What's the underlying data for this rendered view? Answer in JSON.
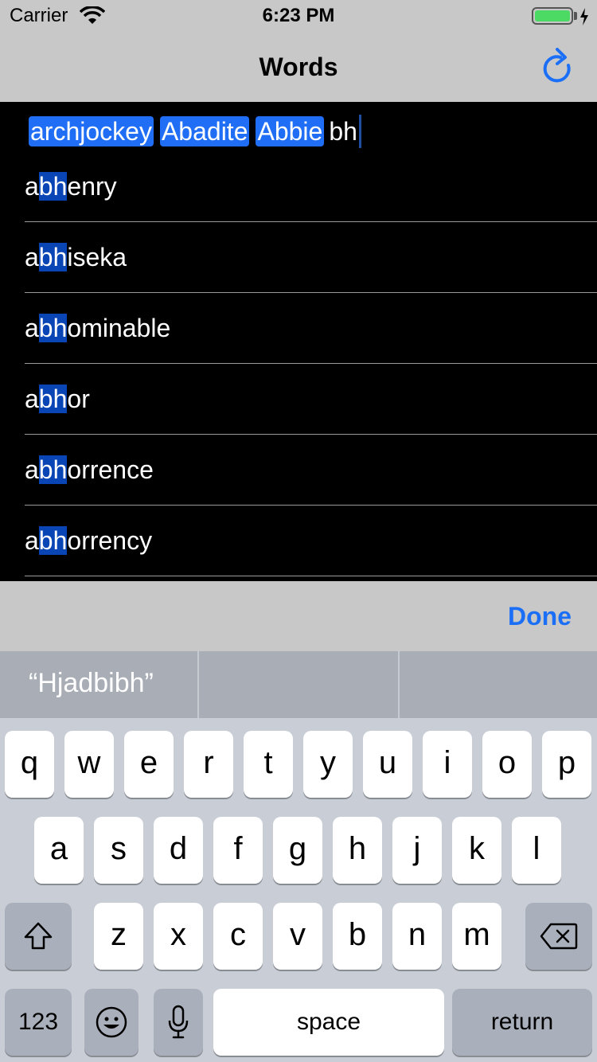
{
  "status_bar": {
    "carrier": "Carrier",
    "time": "6:23 PM",
    "battery_level": 1.0,
    "battery_color": "#4cd964",
    "icons": [
      "wifi-icon",
      "battery-icon",
      "charging-bolt-icon"
    ]
  },
  "nav": {
    "title": "Words",
    "right_icon": "refresh-icon",
    "accent": "#1a6ff6"
  },
  "token_field": {
    "tokens": [
      "archjockey",
      "Abadite",
      "Abbie"
    ],
    "typed": "bh"
  },
  "results": [
    {
      "prefix": "a",
      "match": "bh",
      "rest": "enry"
    },
    {
      "prefix": "a",
      "match": "bh",
      "rest": "iseka"
    },
    {
      "prefix": "a",
      "match": "bh",
      "rest": "ominable"
    },
    {
      "prefix": "a",
      "match": "bh",
      "rest": "or"
    },
    {
      "prefix": "a",
      "match": "bh",
      "rest": "orrence"
    },
    {
      "prefix": "a",
      "match": "bh",
      "rest": "orrency"
    }
  ],
  "accessory": {
    "done_label": "Done"
  },
  "predictive": {
    "suggestions": [
      "“Hjadbibh”",
      "",
      ""
    ]
  },
  "keyboard": {
    "row1": [
      "q",
      "w",
      "e",
      "r",
      "t",
      "y",
      "u",
      "i",
      "o",
      "p"
    ],
    "row2": [
      "a",
      "s",
      "d",
      "f",
      "g",
      "h",
      "j",
      "k",
      "l"
    ],
    "row3": [
      "z",
      "x",
      "c",
      "v",
      "b",
      "n",
      "m"
    ],
    "numbers_label": "123",
    "space_label": "space",
    "return_label": "return",
    "special_icons": [
      "shift-icon",
      "delete-icon",
      "emoji-icon",
      "microphone-icon"
    ]
  }
}
